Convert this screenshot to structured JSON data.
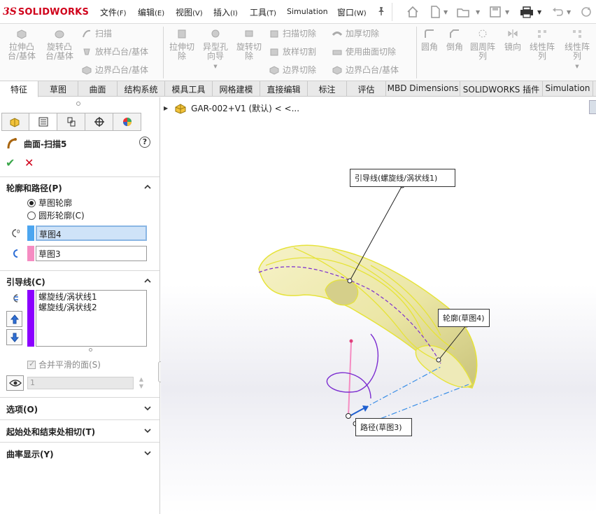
{
  "app": {
    "brand_prefix": "3S",
    "brand_name": "SOLIDWORKS"
  },
  "menu": [
    {
      "label": "文件",
      "key": "(F)"
    },
    {
      "label": "编辑",
      "key": "(E)"
    },
    {
      "label": "视图",
      "key": "(V)"
    },
    {
      "label": "插入",
      "key": "(I)"
    },
    {
      "label": "工具",
      "key": "(T)"
    },
    {
      "label": "Simulation",
      "key": ""
    },
    {
      "label": "窗口",
      "key": "(W)"
    }
  ],
  "ribbon": {
    "extrude_boss": "拉伸凸台/基体",
    "revolve_boss": "旋转凸台/基体",
    "sweep": "扫描",
    "loft": "放样凸台/基体",
    "boundary_boss": "边界凸台/基体",
    "extrude_cut": "拉伸切除",
    "hole_wizard": "异型孔向导",
    "revolve_cut": "旋转切除",
    "swept_cut": "扫描切除",
    "lofted_cut": "放样切割",
    "boundary_cut": "边界切除",
    "thicken_cut": "加厚切除",
    "surface_cut": "使用曲面切除",
    "boundary_boss2": "边界凸台/基体",
    "fillet": "圆角",
    "chamfer": "倒角",
    "circular_pattern": "圆周阵列",
    "mirror": "镜向",
    "linear_pattern": "线性阵列",
    "linear_pattern2": "线性阵列"
  },
  "tabs": [
    {
      "label": "特征",
      "active": true
    },
    {
      "label": "草图"
    },
    {
      "label": "曲面"
    },
    {
      "label": "结构系统"
    },
    {
      "label": "模具工具"
    },
    {
      "label": "网格建模"
    },
    {
      "label": "直接编辑"
    },
    {
      "label": "标注"
    },
    {
      "label": "评估"
    },
    {
      "label": "MBD Dimensions"
    },
    {
      "label": "SOLIDWORKS 插件"
    },
    {
      "label": "Simulation"
    }
  ],
  "property_manager": {
    "title": "曲面-扫描5",
    "profile_path": {
      "title": "轮廓和路径(P)",
      "radio_sketch": "草图轮廓",
      "radio_circle": "圆形轮廓(C)",
      "profile_value": "草图4",
      "path_value": "草图3"
    },
    "guides": {
      "title": "引导线(C)",
      "items": [
        "螺旋线/涡状线1",
        "螺旋线/涡状线2"
      ],
      "merge_label": "合并平滑的面(S)",
      "count_value": "1"
    },
    "options_title": "选项(O)",
    "tangency_title": "起始处和结束处相切(T)",
    "curvature_title": "曲率显示(Y)"
  },
  "viewport": {
    "tree_root": "GAR-002+V1 (默认) < <..."
  },
  "callouts": {
    "guide": "引导线(螺旋线/涡状线1)",
    "profile": "轮廓(草图4)",
    "path": "路径(草图3)"
  },
  "colors": {
    "accent_red": "#d0021b",
    "profile_tag": "#4da6f0",
    "path_tag": "#f58cc2",
    "guide_tag": "#8b00ff",
    "surface_fill": "#f3efb0",
    "surface_edge": "#e6e33a"
  }
}
